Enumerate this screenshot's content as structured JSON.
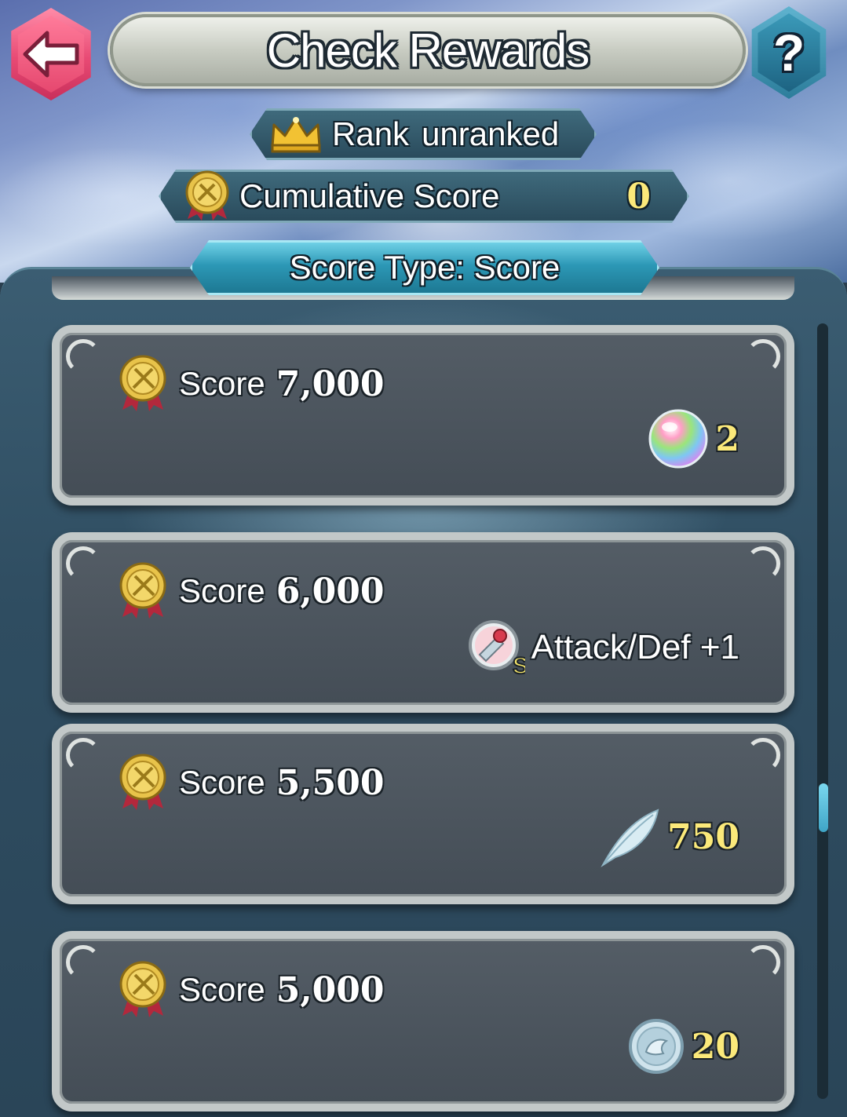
{
  "header": {
    "title": "Check Rewards",
    "back_icon": "back-arrow-icon",
    "help_label": "?"
  },
  "rank": {
    "icon": "crown-icon",
    "label": "Rank",
    "value": "unranked"
  },
  "cumulative": {
    "icon": "medal-icon",
    "label": "Cumulative Score",
    "value": "0"
  },
  "score_type": {
    "label": "Score Type: Score"
  },
  "rewards": [
    {
      "score_label": "Score",
      "score_value": "7,000",
      "reward_icon": "orb-icon",
      "reward_qty": "2"
    },
    {
      "score_label": "Score",
      "score_value": "6,000",
      "reward_icon": "skill-scroll-icon",
      "reward_name": "Attack/Def +1"
    },
    {
      "score_label": "Score",
      "score_value": "5,500",
      "reward_icon": "feather-icon",
      "reward_qty": "750"
    },
    {
      "score_label": "Score",
      "score_value": "5,000",
      "reward_icon": "coin-icon",
      "reward_qty": "20"
    }
  ],
  "colors": {
    "accent_yellow": "#fbe97a",
    "back_button": "#e84a74",
    "help_button": "#2c7d9b",
    "type_plate": "#2c98b6"
  }
}
